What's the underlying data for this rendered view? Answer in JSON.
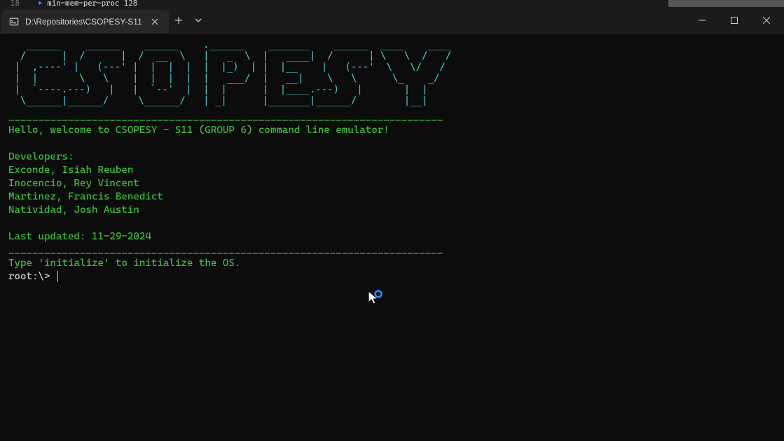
{
  "bg_line_num": "18",
  "bg_line_text": "min-mem-per-proc 128",
  "tab": {
    "title": "D:\\Repositories\\CSOPESY-S11"
  },
  "terminal": {
    "ascii_art": "   ______    ______    ______    .______    _______    ______  ____    ____\n  /      |  /      |  /  __  \\   |   _  \\  |   ____|  /      | \\   \\  /   /\n |  ,----' |   (---' |  |  |  |  |  |_)  | |  |__    |   (---'  \\   \\/   /\n |  |       \\   \\    |  |  |  |  |   ___/  |   __|    \\   \\      \\_    _/\n |  `----.---)   |   |  `--'  |  |  |      |  |____.---)   |       |  |\n  \\______|______/     \\______/   | _|      |_______|______/        |__|",
    "separator": "_________________________________________________________________________",
    "welcome": "Hello, welcome to CSOPESY - S11 (GROUP 6) command line emulator!",
    "dev_header": "Developers:",
    "devs": [
      "Exconde, Isiah Reuben",
      "Inocencio, Rey Vincent",
      "Martinez, Francis Benedict",
      "Natividad, Josh Austin"
    ],
    "last_updated": "Last updated: 11-29-2024",
    "instruction": "Type 'initialize' to initialize the OS.",
    "prompt": "root:\\> "
  }
}
